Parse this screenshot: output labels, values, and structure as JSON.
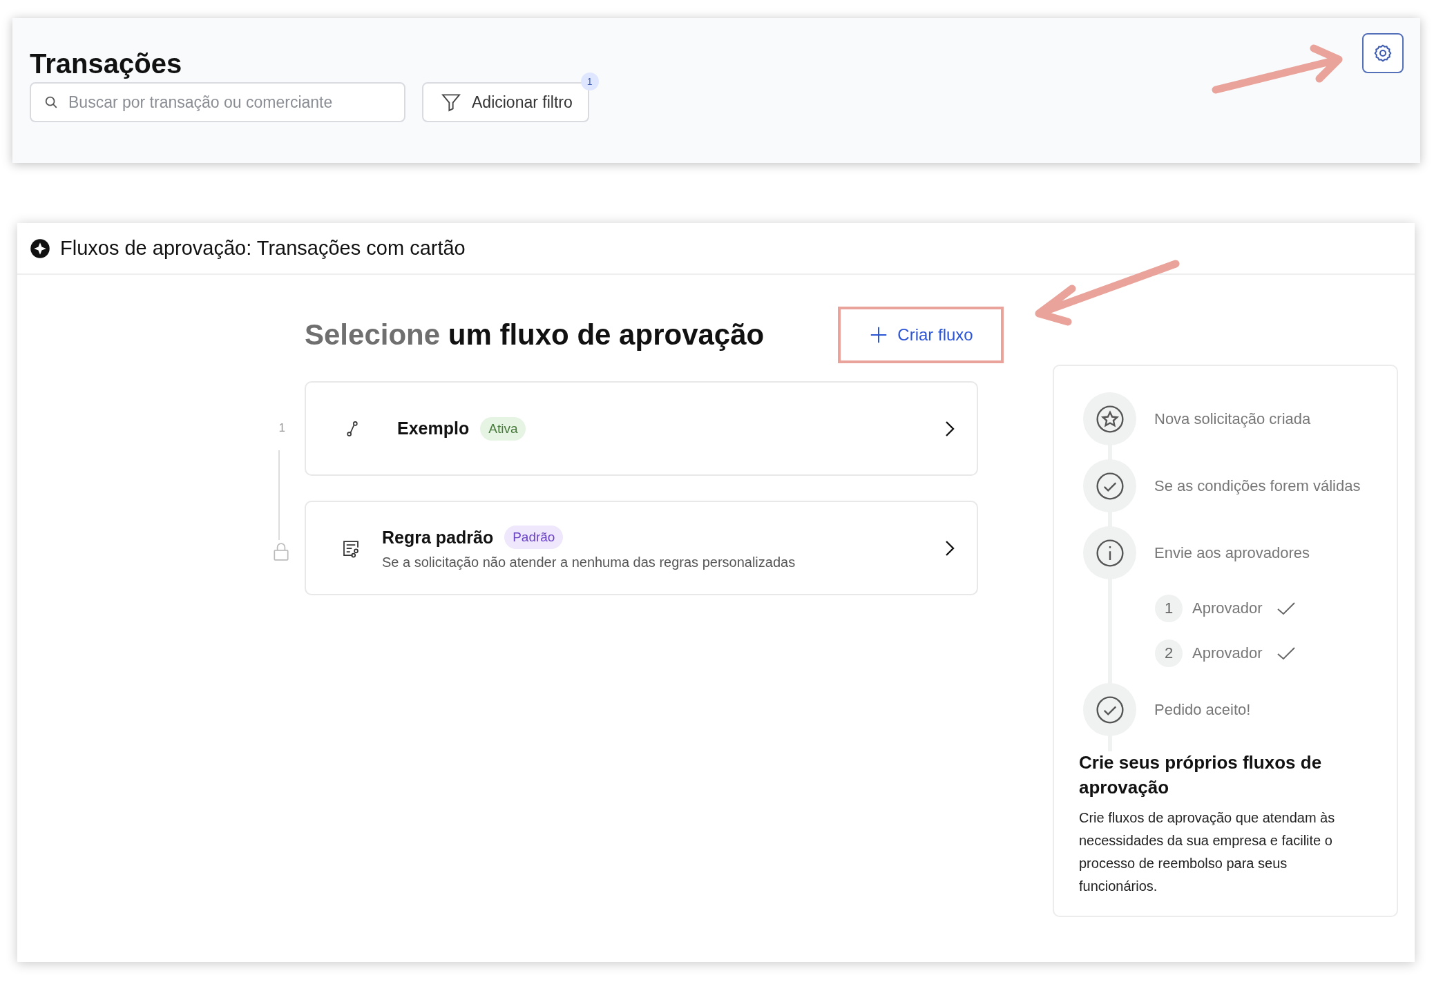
{
  "header": {
    "title": "Transações",
    "search": {
      "placeholder": "Buscar por transação ou comerciante"
    },
    "filter_button": {
      "label": "Adicionar filtro",
      "badge": "1"
    }
  },
  "panel": {
    "title": "Fluxos de aprovação: Transações com cartão",
    "heading_muted": "Selecione",
    "heading": "um fluxo de aprovação",
    "create_button": "Criar fluxo",
    "flows": [
      {
        "kind": "custom",
        "index": "1",
        "name": "Exemplo",
        "tag": "Ativa"
      },
      {
        "kind": "default",
        "name": "Regra padrão",
        "tag": "Padrão",
        "description": "Se a solicitação não atender a nenhuma das regras personalizadas"
      }
    ],
    "preview": {
      "steps": [
        {
          "kind": "star",
          "label": "Nova solicitação criada"
        },
        {
          "kind": "check",
          "label": "Se as condições forem válidas"
        },
        {
          "kind": "info",
          "label": "Envie aos aprovadores",
          "approvers": [
            {
              "number": "1",
              "label": "Aprovador",
              "checked": true
            },
            {
              "number": "2",
              "label": "Aprovador",
              "checked": true
            }
          ]
        },
        {
          "kind": "check",
          "label": "Pedido aceito!"
        }
      ],
      "title": "Crie seus próprios fluxos de aprovação",
      "text": "Crie fluxos de aprovação que atendam às necessidades da sua empresa e facilite o processo de reembolso para seus funcionários."
    }
  }
}
